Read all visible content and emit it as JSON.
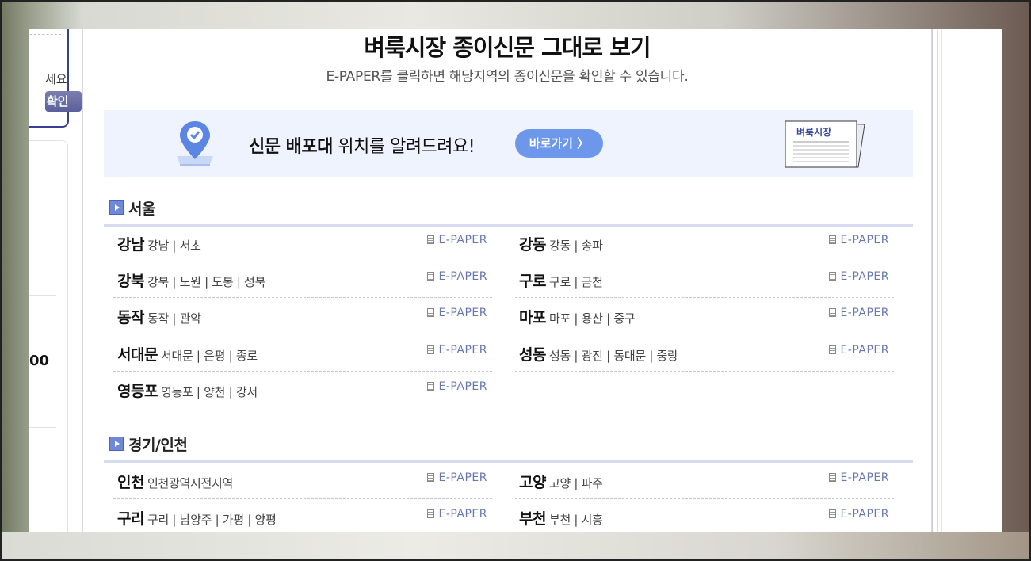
{
  "sidebar": {
    "login_text": "세요",
    "login_button": "확인",
    "stat_value": "00"
  },
  "header": {
    "title": "벼룩시장 종이신문 그대로 보기",
    "subtitle": "E-PAPER를 클릭하면 해당지역의 종이신문을 확인할 수 있습니다."
  },
  "banner": {
    "text_bold": "신문 배포대",
    "text_rest": " 위치를 알려드려요!",
    "button": "바로가기 〉",
    "paper_label": "벼룩시장",
    "accent": "#6c97ea"
  },
  "epaper_label": "E-PAPER",
  "sections": [
    {
      "title": "서울",
      "left": [
        {
          "name": "강남",
          "areas": "강남 | 서초"
        },
        {
          "name": "강북",
          "areas": "강북 | 노원 | 도봉 | 성북"
        },
        {
          "name": "동작",
          "areas": "동작 | 관악"
        },
        {
          "name": "서대문",
          "areas": "서대문 | 은평 | 종로"
        },
        {
          "name": "영등포",
          "areas": "영등포 | 양천 | 강서"
        }
      ],
      "right": [
        {
          "name": "강동",
          "areas": "강동 | 송파"
        },
        {
          "name": "구로",
          "areas": "구로 | 금천"
        },
        {
          "name": "마포",
          "areas": "마포 | 용산 | 중구"
        },
        {
          "name": "성동",
          "areas": "성동 | 광진 | 동대문 | 중랑"
        }
      ]
    },
    {
      "title": "경기/인천",
      "left": [
        {
          "name": "인천",
          "areas": "인천광역시전지역"
        },
        {
          "name": "구리",
          "areas": "구리 | 남양주 | 가평 | 양평"
        }
      ],
      "right": [
        {
          "name": "고양",
          "areas": "고양 | 파주"
        },
        {
          "name": "부천",
          "areas": "부천 | 시흥"
        }
      ]
    }
  ]
}
